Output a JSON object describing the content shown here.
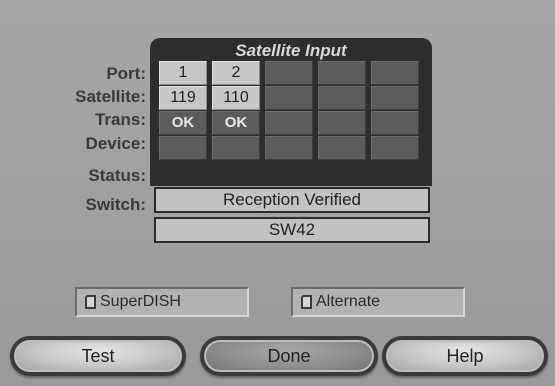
{
  "labels": {
    "port": "Port:",
    "satellite": "Satellite:",
    "trans": "Trans:",
    "device": "Device:",
    "status": "Status:",
    "switch": "Switch:"
  },
  "grid": {
    "title": "Satellite Input",
    "ports": [
      "1",
      "2",
      "",
      "",
      ""
    ],
    "satellites": [
      "119",
      "110",
      "",
      "",
      ""
    ],
    "trans": [
      "OK",
      "OK",
      "",
      "",
      ""
    ],
    "devices": [
      "",
      "",
      "",
      "",
      ""
    ]
  },
  "status_value": "Reception Verified",
  "switch_value": "SW42",
  "choices": {
    "superdish": "SuperDISH",
    "alternate": "Alternate"
  },
  "buttons": {
    "test": "Test",
    "done": "Done",
    "help": "Help"
  }
}
